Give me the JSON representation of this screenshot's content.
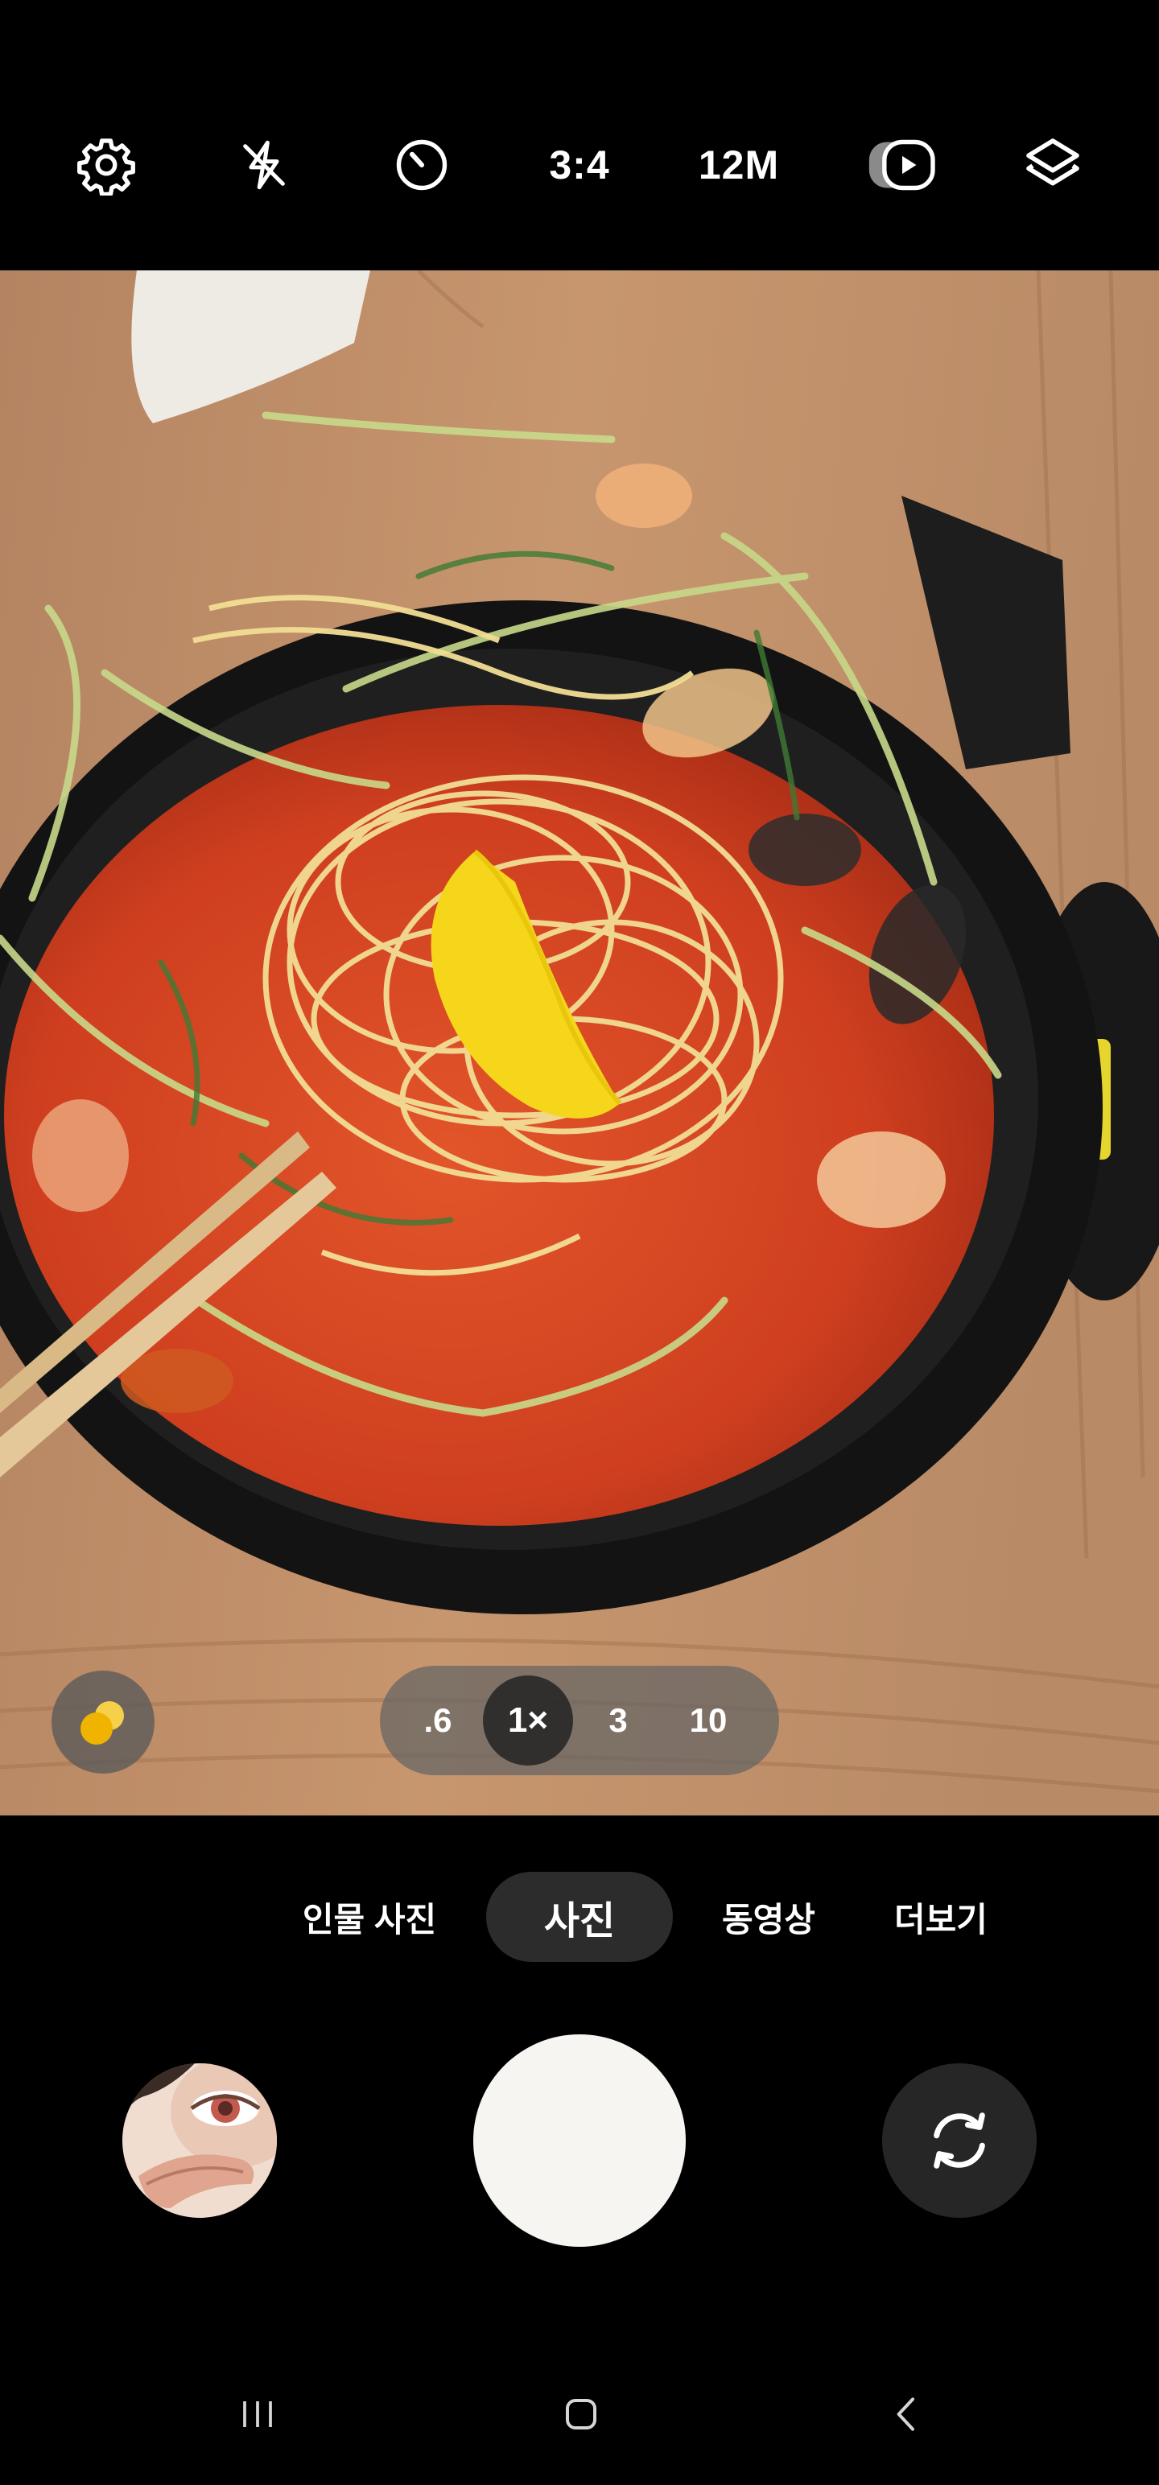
{
  "topbar": {
    "settings_icon": "gear-icon",
    "flash_icon": "flash-off-icon",
    "timer_icon": "timer-icon",
    "ratio_label": "3:4",
    "resolution_label": "12M",
    "motion_photo_icon": "motion-photo-icon",
    "filters_icon": "layers-icon"
  },
  "viewfinder": {
    "effects_icon": "effects-icon",
    "zoom": {
      "options": [
        ".6",
        "1×",
        "3",
        "10"
      ],
      "selected": "1×"
    }
  },
  "modes": {
    "items": [
      "인물 사진",
      "사진",
      "동영상",
      "더보기"
    ],
    "selected": "사진"
  },
  "capture": {
    "gallery_thumbnail": "gallery-thumbnail",
    "shutter": "shutter-button",
    "switch_icon": "switch-camera-icon"
  },
  "navbar": {
    "recents_icon": "recents-icon",
    "home_icon": "home-icon",
    "back_icon": "back-icon"
  },
  "colors": {
    "background": "#000000",
    "shutter": "#f6f5f1",
    "mode_active_bg": "#2c2c2c",
    "effects_accent": "#f5c518"
  }
}
